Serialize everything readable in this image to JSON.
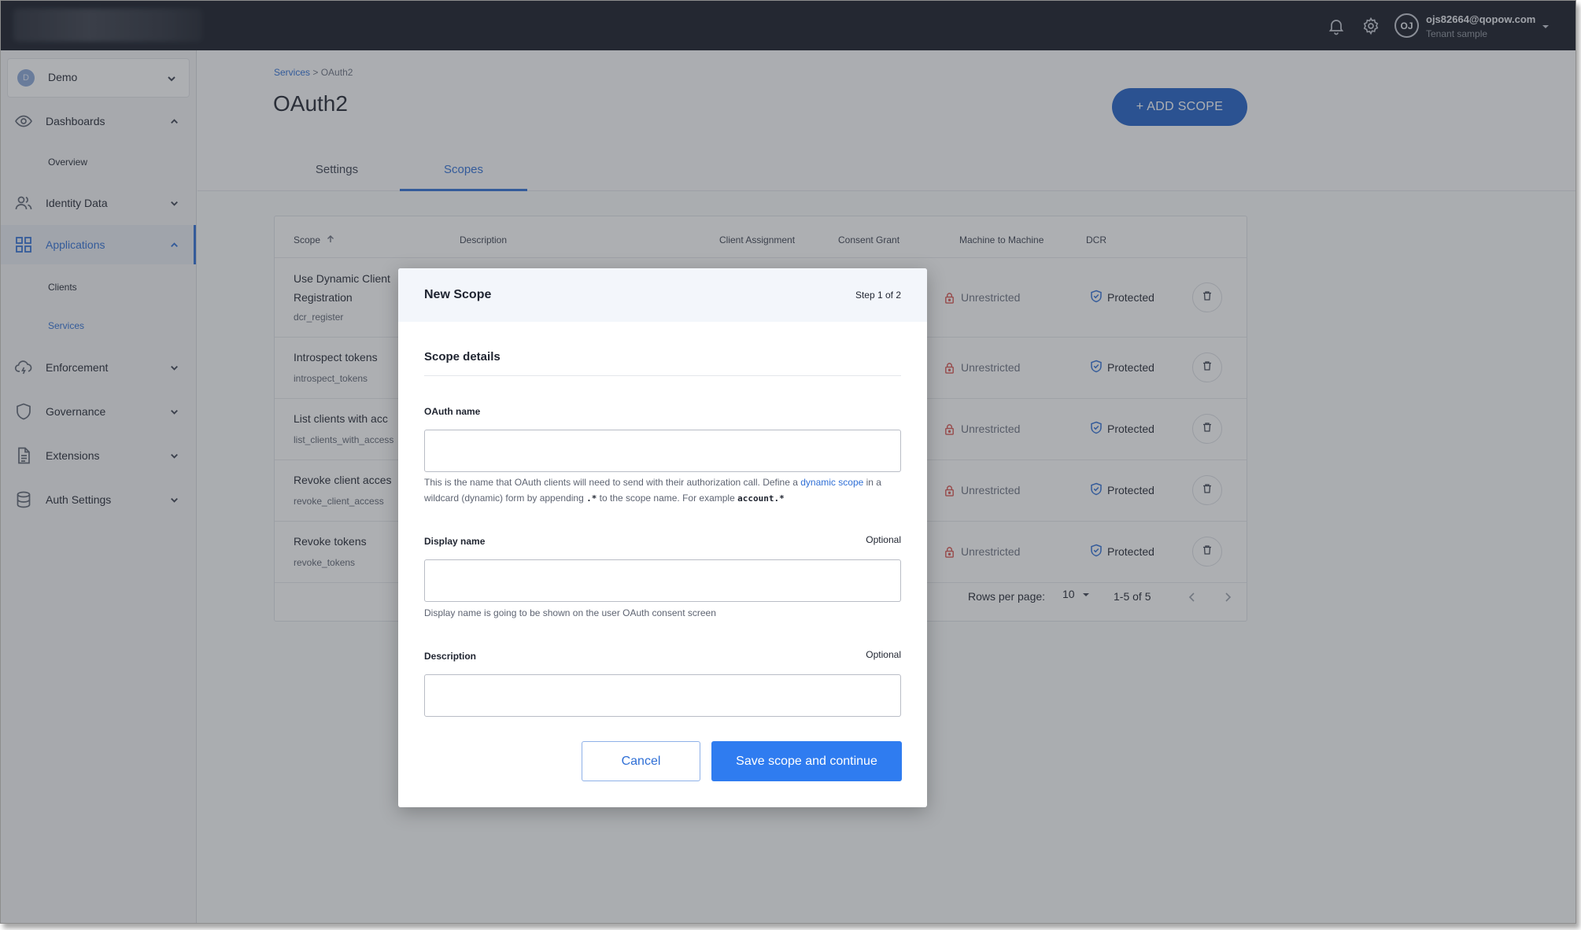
{
  "topbar": {
    "avatar_initials": "OJ",
    "user_email": "ojs82664@qopow.com",
    "user_tenant": "Tenant sample",
    "icons": [
      "bell-icon",
      "gear-icon",
      "chevron-down-icon"
    ]
  },
  "sidebar": {
    "tenant": {
      "initial": "D",
      "name": "Demo"
    },
    "items": [
      {
        "label": "Dashboards",
        "icon": "eye-icon"
      },
      {
        "label": "Identity Data",
        "icon": "users-icon"
      },
      {
        "label": "Applications",
        "icon": "grid-icon"
      },
      {
        "label": "Enforcement",
        "icon": "lightning-cloud-icon"
      },
      {
        "label": "Governance",
        "icon": "shield-icon"
      },
      {
        "label": "Extensions",
        "icon": "document-icon"
      },
      {
        "label": "Auth Settings",
        "icon": "database-icon"
      }
    ],
    "sub_dashboards": [
      "Overview"
    ],
    "sub_applications": [
      "Clients",
      "Services"
    ]
  },
  "header": {
    "breadcrumb_root": "Services",
    "breadcrumb_sep": ">",
    "breadcrumb_current": "OAuth2",
    "title": "OAuth2",
    "add_button": "+ ADD SCOPE",
    "tabs": [
      {
        "label": "Settings"
      },
      {
        "label": "Scopes"
      }
    ]
  },
  "table": {
    "columns": [
      "Scope",
      "Description",
      "Client Assignment",
      "Consent Grant",
      "Machine to Machine",
      "DCR"
    ],
    "rows": [
      {
        "name": "Use Dynamic Client Registration",
        "id": "dcr_register",
        "m2m": "Unrestricted",
        "dcr": "Protected"
      },
      {
        "name": "Introspect tokens",
        "id": "introspect_tokens",
        "m2m": "Unrestricted",
        "dcr": "Protected"
      },
      {
        "name": "List clients with acc",
        "id": "list_clients_with_access",
        "m2m": "Unrestricted",
        "dcr": "Protected"
      },
      {
        "name": "Revoke client acces",
        "id": "revoke_client_access",
        "m2m": "Unrestricted",
        "dcr": "Protected"
      },
      {
        "name": "Revoke tokens",
        "id": "revoke_tokens",
        "m2m": "Unrestricted",
        "dcr": "Protected"
      }
    ],
    "pagination": {
      "rows_per_page_label": "Rows per page:",
      "rows_per_page": "10",
      "range": "1-5 of 5"
    }
  },
  "modal": {
    "title": "New Scope",
    "step": "Step 1 of 2",
    "section_title": "Scope details",
    "oauth_name": {
      "label": "OAuth name",
      "value": "",
      "help_part1": "This is the name that OAuth clients will need to send with their authorization call. Define a ",
      "help_link": "dynamic scope",
      "help_part2": " in a wildcard (dynamic) form by appending ",
      "help_code1": ".*",
      "help_part3": " to the scope name. For example ",
      "help_code2": "account.*"
    },
    "display_name": {
      "label": "Display name",
      "optional": "Optional",
      "value": "",
      "help": "Display name is going to be shown on the user OAuth consent screen"
    },
    "description": {
      "label": "Description",
      "optional": "Optional",
      "value": ""
    },
    "cancel_label": "Cancel",
    "save_label": "Save scope and continue"
  },
  "colors": {
    "accent": "#2f6fd6",
    "primary_button": "#2f7cf0",
    "topbar": "#141824",
    "danger": "#d9534f"
  }
}
